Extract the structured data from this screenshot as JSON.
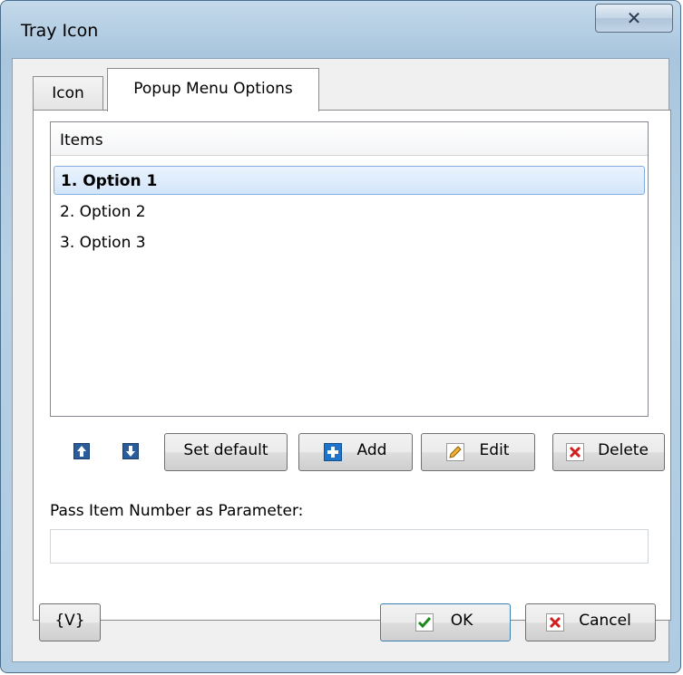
{
  "window": {
    "title": "Tray Icon",
    "close_symbol": "✕"
  },
  "tabs": [
    {
      "label": "Icon",
      "active": false
    },
    {
      "label": "Popup Menu Options",
      "active": true
    }
  ],
  "list": {
    "header": "Items",
    "items": [
      {
        "label": "1. Option 1",
        "selected": true
      },
      {
        "label": "2. Option 2",
        "selected": false
      },
      {
        "label": "3. Option 3",
        "selected": false
      }
    ]
  },
  "toolbar": {
    "move_up_icon": "arrow-up-icon",
    "move_down_icon": "arrow-down-icon",
    "set_default_label": "Set default",
    "add_label": "Add",
    "edit_label": "Edit",
    "delete_label": "Delete"
  },
  "parameter": {
    "label": "Pass Item Number as Parameter:",
    "value": ""
  },
  "footer": {
    "variables_label": "{V}",
    "ok_label": "OK",
    "cancel_label": "Cancel"
  },
  "colors": {
    "selection": "#d3e5fa",
    "add_icon": "#1f73c9",
    "delete_icon": "#d12020",
    "ok_check": "#1b8a1b"
  }
}
